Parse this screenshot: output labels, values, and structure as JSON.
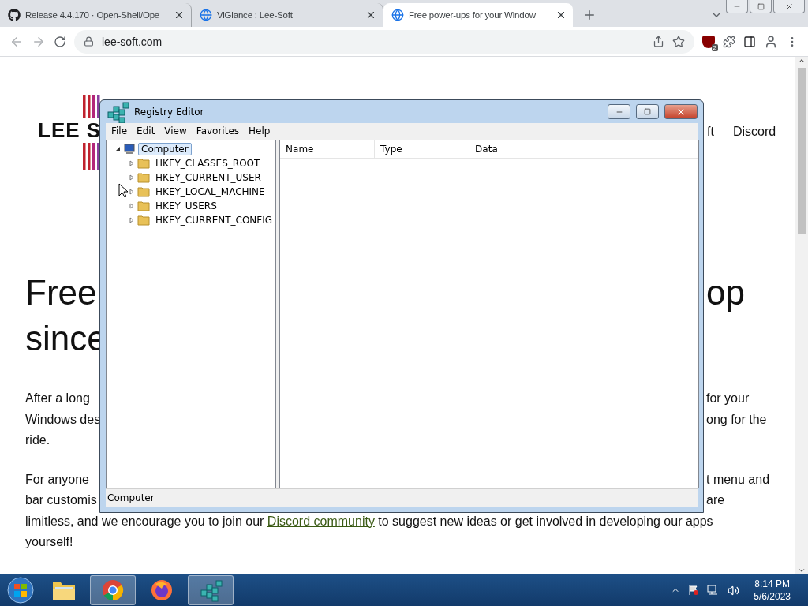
{
  "browser": {
    "tabs": [
      {
        "kind": "github",
        "title": "Release 4.4.170 · Open-Shell/Ope",
        "selected": false
      },
      {
        "kind": "globe",
        "title": "ViGlance : Lee-Soft",
        "selected": false
      },
      {
        "kind": "globe",
        "title": "Free power-ups for your Window",
        "selected": true
      }
    ],
    "address": "lee-soft.com",
    "extension_badge": "2"
  },
  "page": {
    "logo": "LEE S",
    "nav": [
      "ft",
      "Discord"
    ],
    "headline": [
      {
        "left": "Free",
        "right": "op"
      },
      {
        "left": "since"
      }
    ],
    "paragraphs": [
      [
        {
          "left": "After a long",
          "right": "for your"
        },
        {
          "left": "Windows des",
          "right": "ong for the"
        },
        {
          "left": "ride."
        }
      ],
      [
        {
          "left": "For anyone",
          "right": "t menu and"
        },
        {
          "left": "bar customis",
          "right": "are"
        }
      ]
    ],
    "closing": [
      {
        "text": "limitless, and we encourage you to join our ",
        "link": "Discord community",
        "after": " to suggest new ideas or get involved in developing our apps"
      },
      {
        "text": "yourself!"
      }
    ]
  },
  "regedit": {
    "title": "Registry Editor",
    "menu": [
      "File",
      "Edit",
      "View",
      "Favorites",
      "Help"
    ],
    "tree": {
      "label": "Computer",
      "selected": true,
      "expanded": true,
      "children": [
        {
          "label": "HKEY_CLASSES_ROOT",
          "expanded": false
        },
        {
          "label": "HKEY_CURRENT_USER",
          "expanded": false
        },
        {
          "label": "HKEY_LOCAL_MACHINE",
          "expanded": false
        },
        {
          "label": "HKEY_USERS",
          "expanded": false
        },
        {
          "label": "HKEY_CURRENT_CONFIG",
          "expanded": false
        }
      ]
    },
    "columns": [
      "Name",
      "Type",
      "Data"
    ],
    "status": "Computer"
  },
  "taskbar": {
    "apps": [
      {
        "kind": "explorer",
        "active": false
      },
      {
        "kind": "chrome",
        "active": true
      },
      {
        "kind": "firefox",
        "active": false
      },
      {
        "kind": "regedit",
        "active": true
      }
    ],
    "time": "8:14 PM",
    "date": "5/6/2023"
  }
}
